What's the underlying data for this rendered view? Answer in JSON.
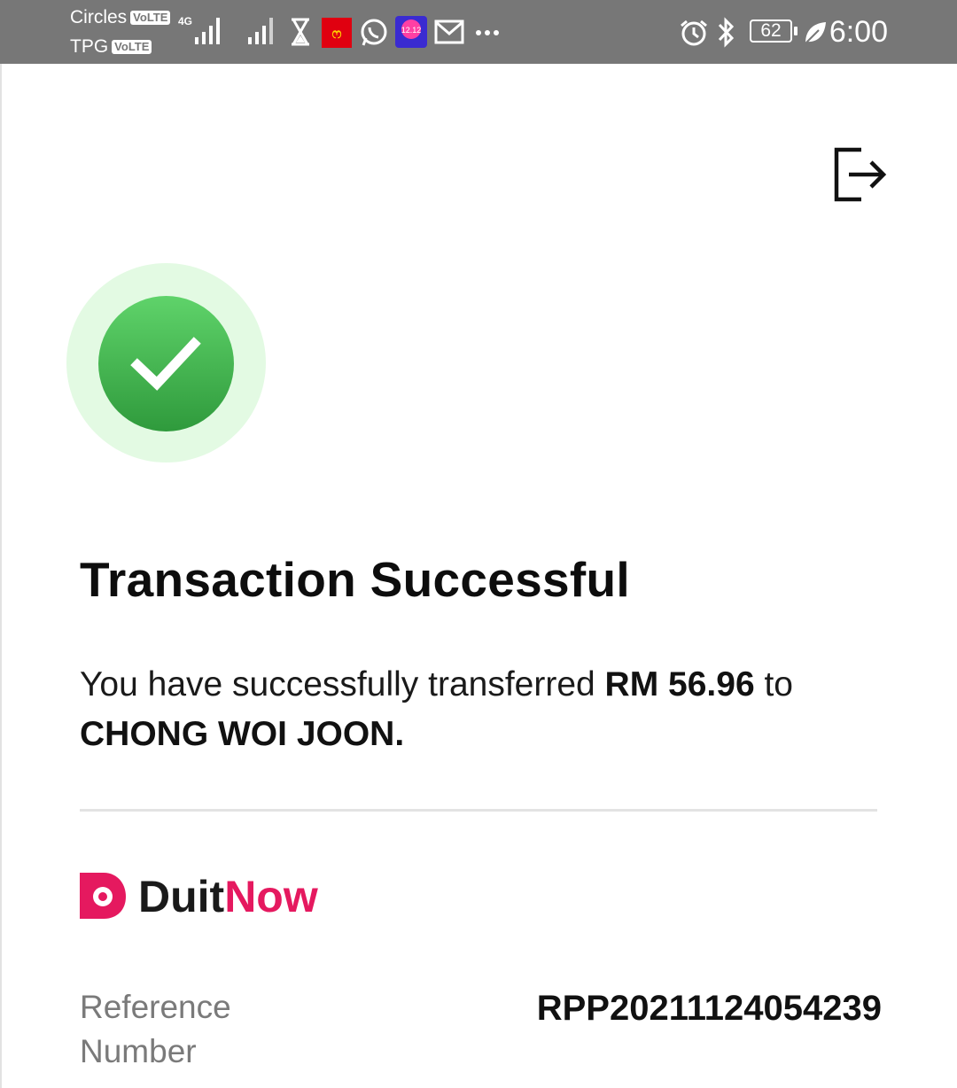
{
  "status_bar": {
    "carrier_1": "Circles",
    "carrier_2": "TPG",
    "volte_badge": "VoLTE",
    "network_type": "4G",
    "battery_level": "62",
    "time": "6:00"
  },
  "header": {
    "exit_icon": "logout-icon"
  },
  "result": {
    "title": "Transaction Successful",
    "message_prefix": "You have successfully transferred ",
    "amount": "RM 56.96",
    "message_mid": " to ",
    "recipient": "CHONG WOI JOON."
  },
  "payment_network": {
    "name_part1": "Duit",
    "name_part2": "Now"
  },
  "details": {
    "reference_label": "Reference Number",
    "reference_value": "RPP20211124054239"
  },
  "colors": {
    "success_green": "#3fb04b",
    "halo": "#e3fae3",
    "brand_pink": "#e5195f",
    "status_bar": "#777777"
  }
}
